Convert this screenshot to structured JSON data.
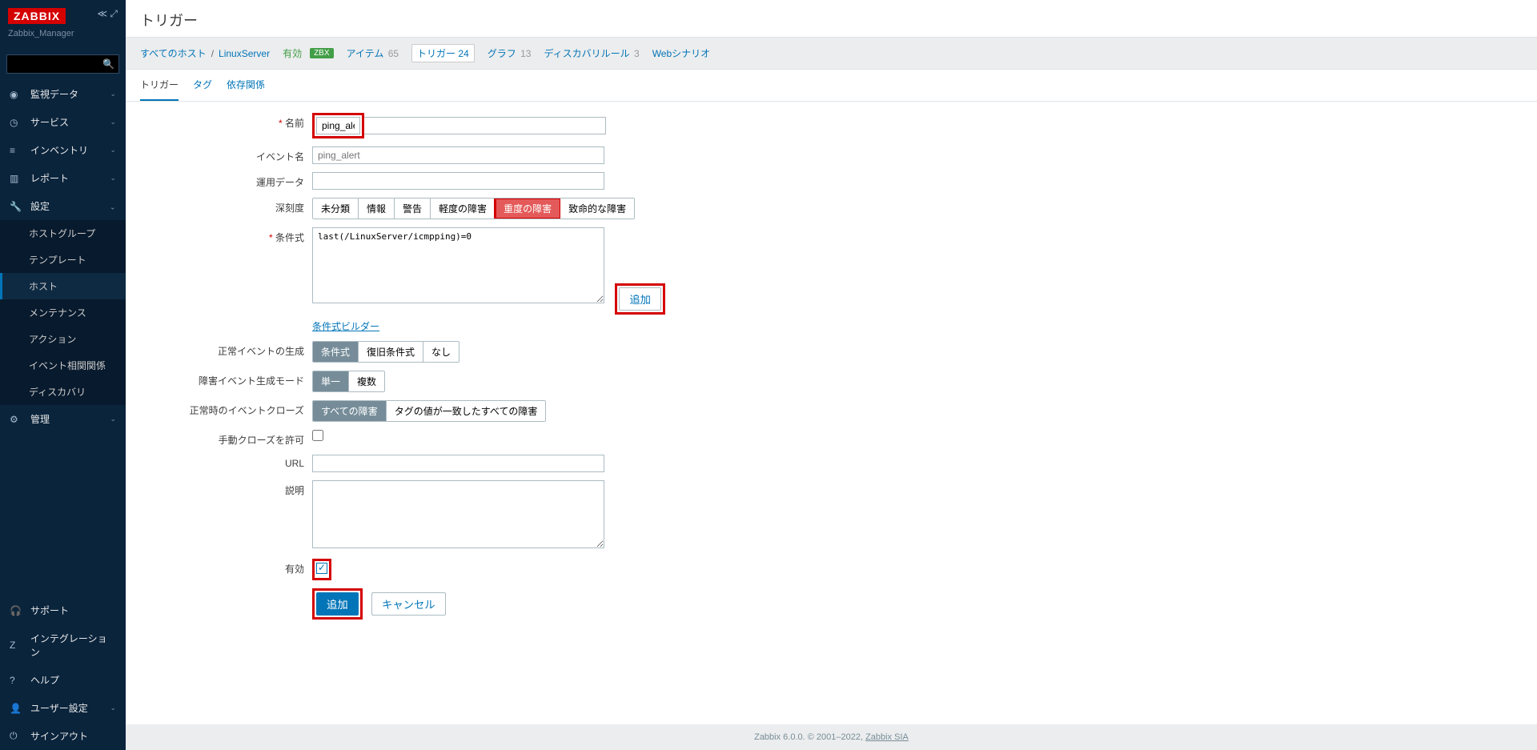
{
  "logo": "ZABBIX",
  "manager_name": "Zabbix_Manager",
  "search": {
    "placeholder": ""
  },
  "nav": {
    "monitoring": "監視データ",
    "services": "サービス",
    "inventory": "インベントリ",
    "reports": "レポート",
    "settings": "設定",
    "admin": "管理"
  },
  "subnav": {
    "hostgroups": "ホストグループ",
    "templates": "テンプレート",
    "hosts": "ホスト",
    "maintenance": "メンテナンス",
    "actions": "アクション",
    "event_correlation": "イベント相関関係",
    "discovery": "ディスカバリ"
  },
  "bottom_nav": {
    "support": "サポート",
    "integration": "インテグレーション",
    "help": "ヘルプ",
    "user_settings": "ユーザー設定",
    "signout": "サインアウト"
  },
  "page_title": "トリガー",
  "breadcrumb": {
    "all_hosts": "すべてのホスト",
    "host": "LinuxServer",
    "enabled": "有効",
    "zbx": "ZBX",
    "items": "アイテム",
    "items_count": "65",
    "triggers": "トリガー",
    "triggers_count": "24",
    "graphs": "グラフ",
    "graphs_count": "13",
    "discovery": "ディスカバリルール",
    "discovery_count": "3",
    "web": "Webシナリオ"
  },
  "tabs": {
    "trigger": "トリガー",
    "tags": "タグ",
    "dependencies": "依存関係"
  },
  "form": {
    "name_label": "名前",
    "name_value": "ping_alert",
    "event_name_label": "イベント名",
    "event_name_placeholder": "ping_alert",
    "op_data_label": "運用データ",
    "severity_label": "深刻度",
    "severity": {
      "not_classified": "未分類",
      "information": "情報",
      "warning": "警告",
      "average": "軽度の障害",
      "high": "重度の障害",
      "disaster": "致命的な障害"
    },
    "expression_label": "条件式",
    "expression_value": "last(/LinuxServer/icmpping)=0",
    "add_button": "追加",
    "expression_builder": "条件式ビルダー",
    "ok_event_label": "正常イベントの生成",
    "ok_event": {
      "expression": "条件式",
      "recovery": "復旧条件式",
      "none": "なし"
    },
    "problem_mode_label": "障害イベント生成モード",
    "problem_mode": {
      "single": "単一",
      "multiple": "複数"
    },
    "ok_close_label": "正常時のイベントクローズ",
    "ok_close": {
      "all": "すべての障害",
      "match": "タグの値が一致したすべての障害"
    },
    "manual_close_label": "手動クローズを許可",
    "url_label": "URL",
    "description_label": "説明",
    "enabled_label": "有効",
    "submit": "追加",
    "cancel": "キャンセル"
  },
  "footer": {
    "text": "Zabbix 6.0.0. © 2001–2022, ",
    "link": "Zabbix SIA"
  }
}
